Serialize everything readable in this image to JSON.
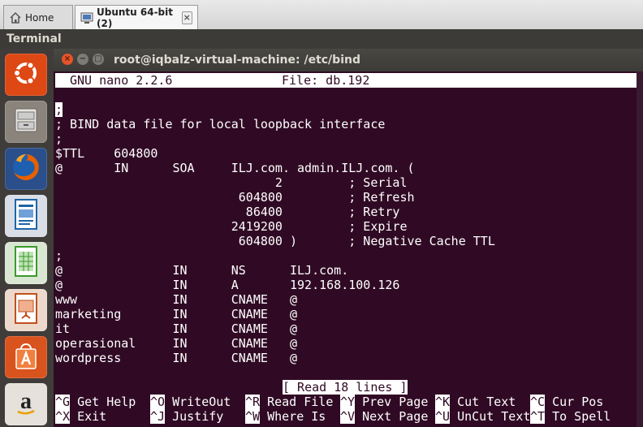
{
  "tabs": [
    {
      "label": "Home",
      "icon": "home-icon"
    },
    {
      "label": "Ubuntu 64-bit (2)",
      "icon": "vm-icon",
      "close": "×"
    }
  ],
  "menubar": {
    "app_name": "Terminal"
  },
  "launcher": {
    "items": [
      {
        "name": "ubuntu-dash",
        "icon": "ubuntu-logo-icon",
        "color": "#dd4814"
      },
      {
        "name": "files",
        "icon": "file-cabinet-icon",
        "color": "#b8b0a4"
      },
      {
        "name": "firefox",
        "icon": "firefox-icon",
        "color": "#e66000"
      },
      {
        "name": "writer",
        "icon": "document-icon",
        "color": "#1e64a8"
      },
      {
        "name": "calc",
        "icon": "spreadsheet-icon",
        "color": "#3a9a2a"
      },
      {
        "name": "impress",
        "icon": "presentation-icon",
        "color": "#c0501e"
      },
      {
        "name": "software-center",
        "icon": "shopping-bag-icon",
        "color": "#d9531e"
      },
      {
        "name": "amazon",
        "icon": "amazon-icon",
        "color": "#e6e1da"
      }
    ]
  },
  "window": {
    "title": "root@iqbalz-virtual-machine: /etc/bind",
    "close": "×",
    "minimize": "−",
    "maximize": "□"
  },
  "nano": {
    "version": "GNU nano 2.2.6",
    "file": "File: db.192",
    "cursor_char": ";",
    "lines": [
      "",
      "; BIND data file for local loopback interface",
      ";",
      "$TTL    604800",
      "@       IN      SOA     ILJ.com. admin.ILJ.com. (",
      "                              2         ; Serial",
      "                         604800         ; Refresh",
      "                          86400         ; Retry",
      "                        2419200         ; Expire",
      "                         604800 )       ; Negative Cache TTL",
      ";",
      "@               IN      NS      ILJ.com.",
      "@               IN      A       192.168.100.126",
      "www             IN      CNAME   @",
      "marketing       IN      CNAME   @",
      "it              IN      CNAME   @",
      "operasional     IN      CNAME   @",
      "wordpress       IN      CNAME   @"
    ],
    "status": "[ Read 18 lines ]",
    "shortcuts_row1": [
      {
        "key": "^G",
        "label": "Get Help"
      },
      {
        "key": "^O",
        "label": "WriteOut"
      },
      {
        "key": "^R",
        "label": "Read File"
      },
      {
        "key": "^Y",
        "label": "Prev Page"
      },
      {
        "key": "^K",
        "label": "Cut Text"
      },
      {
        "key": "^C",
        "label": "Cur Pos"
      }
    ],
    "shortcuts_row2": [
      {
        "key": "^X",
        "label": "Exit"
      },
      {
        "key": "^J",
        "label": "Justify"
      },
      {
        "key": "^W",
        "label": "Where Is"
      },
      {
        "key": "^V",
        "label": "Next Page"
      },
      {
        "key": "^U",
        "label": "UnCut Text"
      },
      {
        "key": "^T",
        "label": "To Spell"
      }
    ]
  }
}
